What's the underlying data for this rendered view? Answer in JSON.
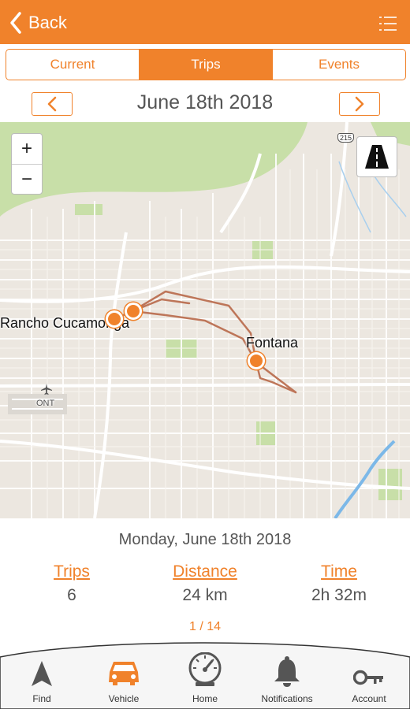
{
  "header": {
    "back_label": "Back"
  },
  "tabs": [
    {
      "label": "Current",
      "active": false
    },
    {
      "label": "Trips",
      "active": true
    },
    {
      "label": "Events",
      "active": false
    }
  ],
  "date_nav": {
    "title": "June 18th 2018"
  },
  "map": {
    "zoom_in": "+",
    "zoom_out": "−",
    "labels": {
      "city1": "Rancho Cucamonga",
      "city2": "Fontana",
      "airport": "ONT",
      "highway": "215"
    },
    "trip_color": "#b9694a"
  },
  "summary": {
    "date": "Monday, June 18th 2018",
    "trips_label": "Trips",
    "trips_value": "6",
    "distance_label": "Distance",
    "distance_value": "24 km",
    "time_label": "Time",
    "time_value": "2h 32m",
    "pager": "1 / 14"
  },
  "bottom_nav": [
    {
      "label": "Find",
      "icon": "navigation-arrow-icon"
    },
    {
      "label": "Vehicle",
      "icon": "car-icon",
      "active": true
    },
    {
      "label": "Home",
      "icon": "speedometer-icon"
    },
    {
      "label": "Notifications",
      "icon": "bell-icon"
    },
    {
      "label": "Account",
      "icon": "key-icon"
    }
  ],
  "colors": {
    "accent": "#f0822b",
    "map_bg": "#ece7e0",
    "park": "#c8dfa8"
  }
}
